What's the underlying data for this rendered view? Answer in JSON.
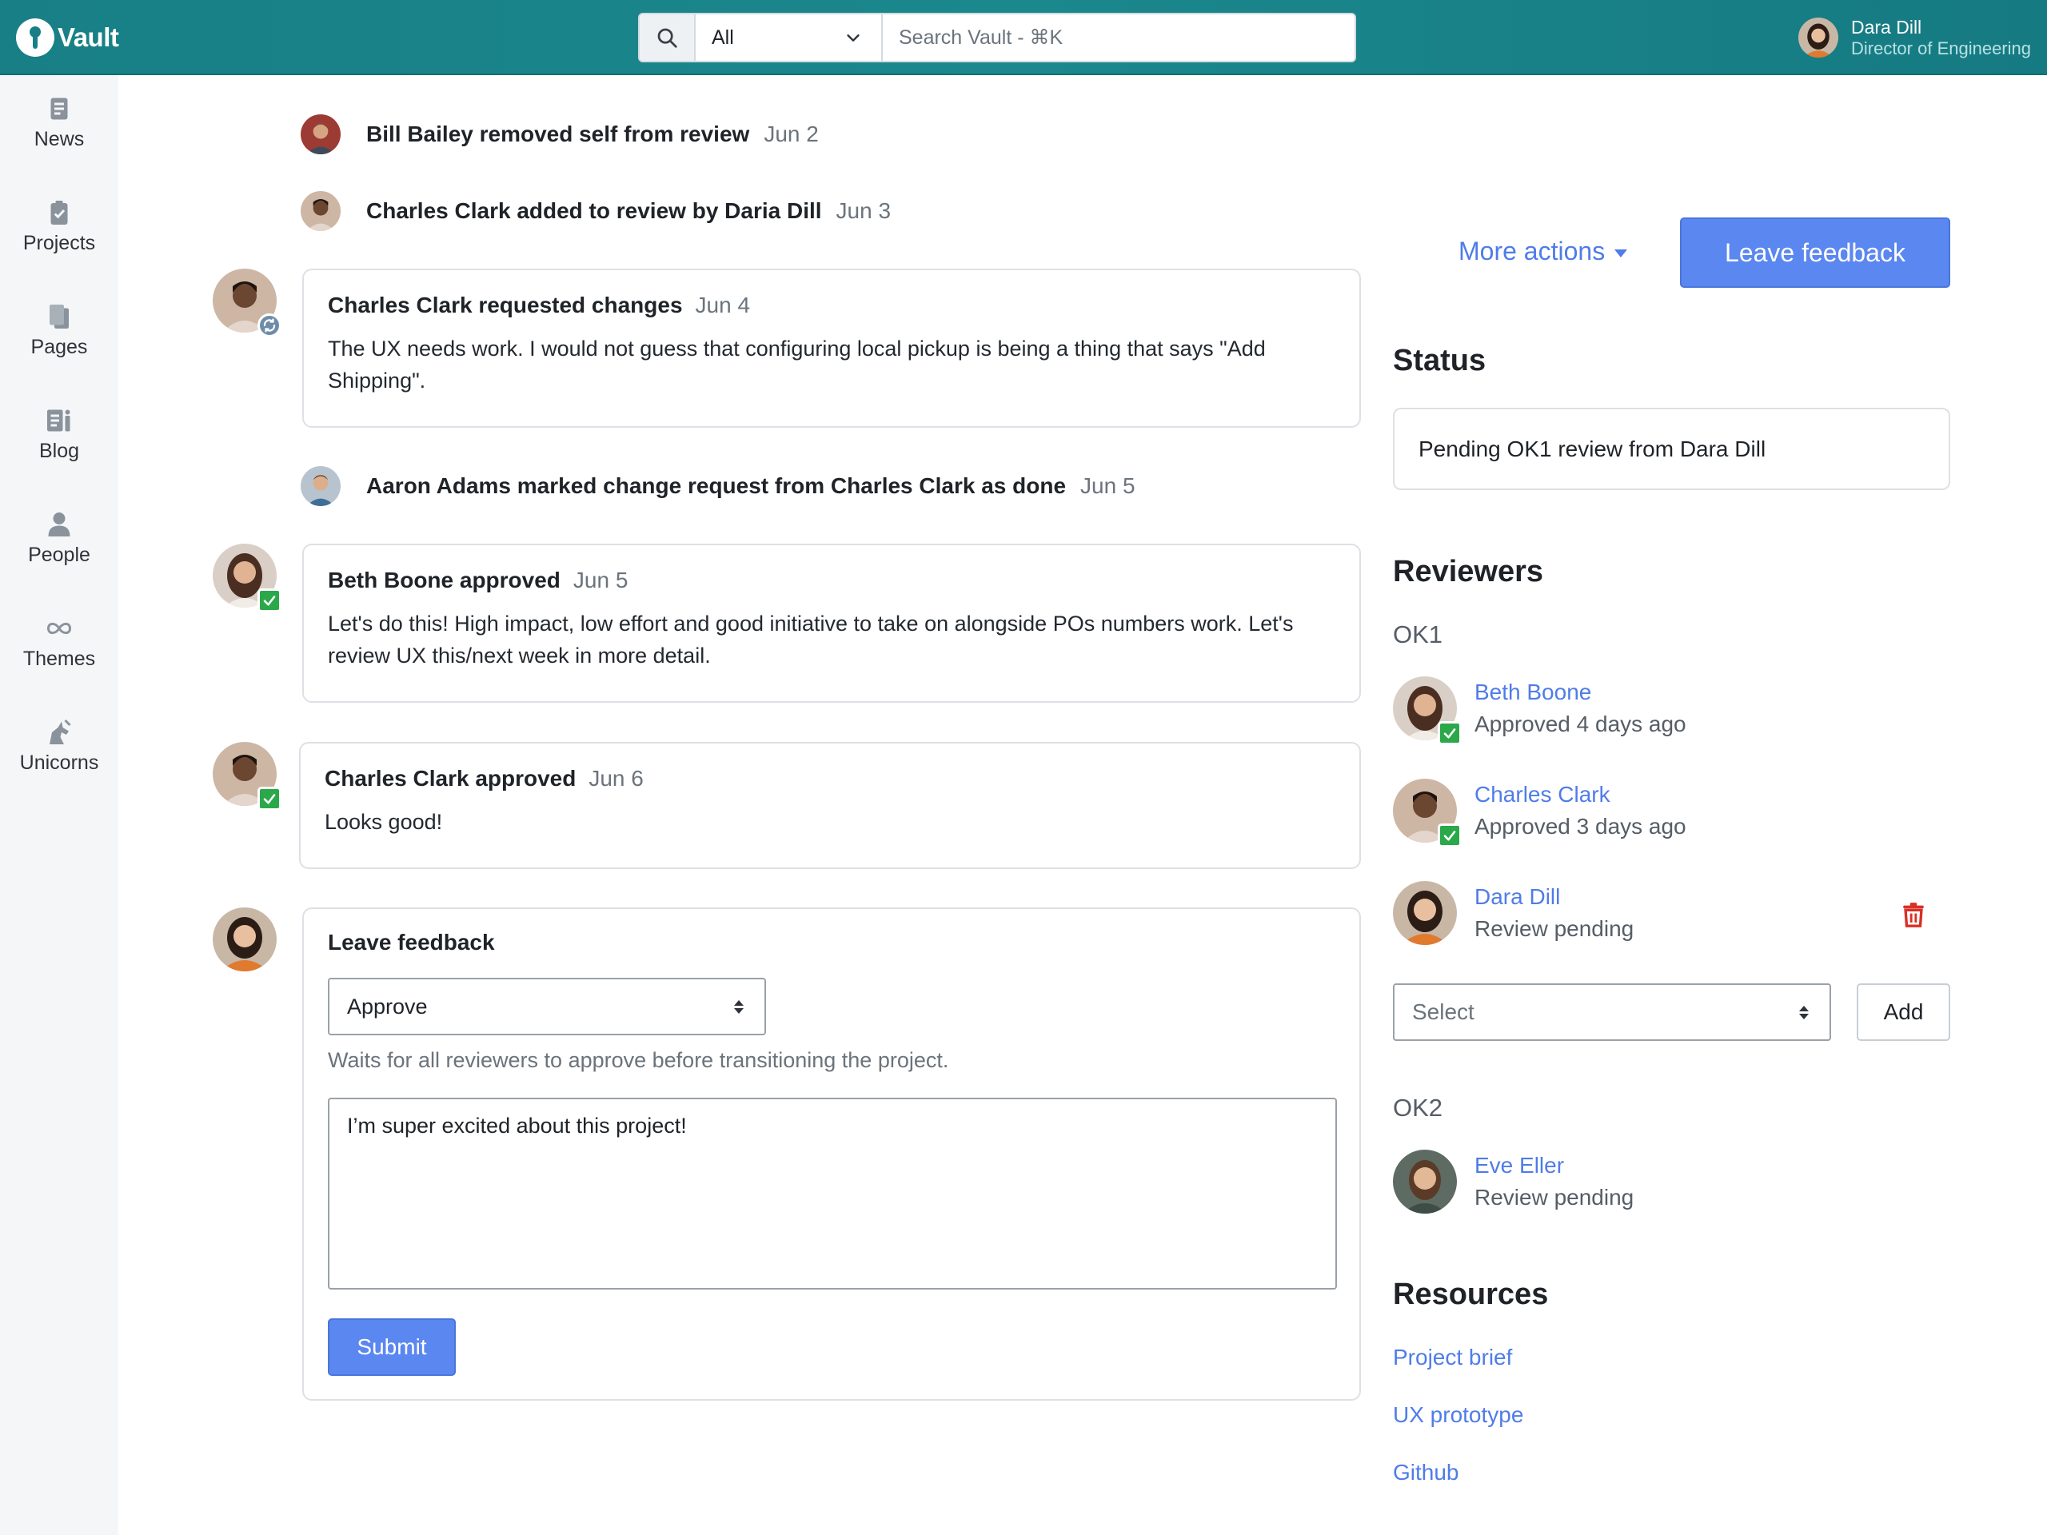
{
  "app": {
    "name": "Vault"
  },
  "search": {
    "scope": "All",
    "placeholder": "Search Vault - ⌘K"
  },
  "user": {
    "name": "Dara Dill",
    "title": "Director of Engineering"
  },
  "nav": [
    {
      "label": "News",
      "icon": "news-icon"
    },
    {
      "label": "Projects",
      "icon": "clipboard-icon"
    },
    {
      "label": "Pages",
      "icon": "pages-icon"
    },
    {
      "label": "Blog",
      "icon": "blog-icon"
    },
    {
      "label": "People",
      "icon": "person-icon"
    },
    {
      "label": "Themes",
      "icon": "infinity-icon"
    },
    {
      "label": "Unicorns",
      "icon": "unicorn-icon"
    }
  ],
  "timeline": {
    "events": [
      {
        "text": "Bill Bailey removed self from review",
        "date": "Jun 2"
      },
      {
        "text": "Charles Clark added to review by Daria Dill",
        "date": "Jun 3"
      },
      {
        "text": "Aaron Adams marked change request from Charles Clark as done",
        "date": "Jun 5"
      }
    ],
    "cards": [
      {
        "title": "Charles Clark requested changes",
        "date": "Jun 4",
        "body": "The UX needs work. I would not guess that configuring local pickup is being a thing that says \"Add Shipping\"."
      },
      {
        "title": "Beth Boone approved",
        "date": "Jun 5",
        "body": "Let's do this! High impact, low effort and good initiative to take on alongside POs numbers work. Let's review UX this/next week in more detail."
      },
      {
        "title": "Charles Clark approved",
        "date": "Jun 6",
        "body": "Looks good!"
      }
    ]
  },
  "feedback_form": {
    "title": "Leave feedback",
    "decision": "Approve",
    "hint": "Waits for all reviewers to approve before transitioning the project.",
    "comment": "I’m super excited about this project!",
    "submit_label": "Submit"
  },
  "actions": {
    "more_label": "More actions",
    "leave_feedback_label": "Leave feedback"
  },
  "status": {
    "heading": "Status",
    "text": "Pending OK1 review from Dara Dill"
  },
  "reviewers": {
    "heading": "Reviewers",
    "groups": [
      {
        "label": "OK1",
        "people": [
          {
            "name": "Beth Boone",
            "state": "Approved 4 days ago"
          },
          {
            "name": "Charles Clark",
            "state": "Approved 3 days ago"
          },
          {
            "name": "Dara Dill",
            "state": "Review pending"
          }
        ]
      },
      {
        "label": "OK2",
        "people": [
          {
            "name": "Eve Eller",
            "state": "Review pending"
          }
        ]
      }
    ],
    "select_placeholder": "Select",
    "add_label": "Add"
  },
  "resources": {
    "heading": "Resources",
    "links": [
      "Project brief",
      "UX prototype",
      "Github"
    ]
  },
  "colors": {
    "header": "#187f86",
    "accent": "#4f7ce8",
    "primary_button": "#5b87f0",
    "approved": "#2ba84a",
    "danger": "#d93025"
  }
}
